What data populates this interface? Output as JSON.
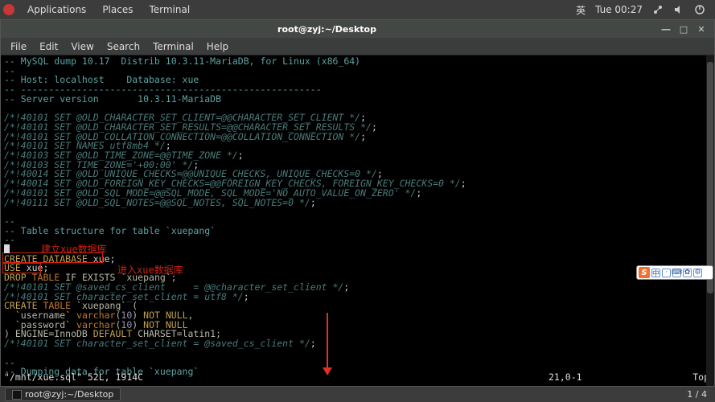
{
  "top_panel": {
    "menu": [
      "Applications",
      "Places",
      "Terminal"
    ],
    "ime_lang": "英",
    "clock": "Tue 00:27"
  },
  "window": {
    "title": "root@zyj:~/Desktop",
    "menubar": [
      "File",
      "Edit",
      "View",
      "Search",
      "Terminal",
      "Help"
    ]
  },
  "terminal_lines": [
    [
      [
        "c-cyan",
        "-- MySQL dump 10.17  Distrib 10.3.11-MariaDB, for Linux (x86_64)"
      ]
    ],
    [
      [
        "c-cyan",
        "--"
      ]
    ],
    [
      [
        "c-cyan",
        "-- Host: localhost    Database: xue"
      ]
    ],
    [
      [
        "c-cyan",
        "-- ------------------------------------------------------"
      ]
    ],
    [
      [
        "c-cyan",
        "-- Server version       10.3.11-MariaDB"
      ]
    ],
    [
      [
        "c-white",
        ""
      ]
    ],
    [
      [
        "c-comment",
        "/*!40101 SET @OLD_CHARACTER_SET_CLIENT=@@CHARACTER_SET_CLIENT */"
      ],
      [
        "c-white",
        ";"
      ]
    ],
    [
      [
        "c-comment",
        "/*!40101 SET @OLD_CHARACTER_SET_RESULTS=@@CHARACTER_SET_RESULTS */"
      ],
      [
        "c-white",
        ";"
      ]
    ],
    [
      [
        "c-comment",
        "/*!40101 SET @OLD_COLLATION_CONNECTION=@@COLLATION_CONNECTION */"
      ],
      [
        "c-white",
        ";"
      ]
    ],
    [
      [
        "c-comment",
        "/*!40101 SET NAMES utf8mb4 */"
      ],
      [
        "c-white",
        ";"
      ]
    ],
    [
      [
        "c-comment",
        "/*!40103 SET @OLD_TIME_ZONE=@@TIME_ZONE */"
      ],
      [
        "c-white",
        ";"
      ]
    ],
    [
      [
        "c-comment",
        "/*!40103 SET TIME_ZONE='+00:00' */"
      ],
      [
        "c-white",
        ";"
      ]
    ],
    [
      [
        "c-comment",
        "/*!40014 SET @OLD_UNIQUE_CHECKS=@@UNIQUE_CHECKS, UNIQUE_CHECKS=0 */"
      ],
      [
        "c-white",
        ";"
      ]
    ],
    [
      [
        "c-comment",
        "/*!40014 SET @OLD_FOREIGN_KEY_CHECKS=@@FOREIGN_KEY_CHECKS, FOREIGN_KEY_CHECKS=0 */"
      ],
      [
        "c-white",
        ";"
      ]
    ],
    [
      [
        "c-comment",
        "/*!40101 SET @OLD_SQL_MODE=@@SQL_MODE, SQL_MODE='NO_AUTO_VALUE_ON_ZERO' */"
      ],
      [
        "c-white",
        ";"
      ]
    ],
    [
      [
        "c-comment",
        "/*!40111 SET @OLD_SQL_NOTES=@@SQL_NOTES, SQL_NOTES=0 */"
      ],
      [
        "c-white",
        ";"
      ]
    ],
    [
      [
        "c-white",
        ""
      ]
    ],
    [
      [
        "c-cyan",
        "--"
      ]
    ],
    [
      [
        "c-cyan",
        "-- Table structure for table `xuepang`"
      ]
    ],
    [
      [
        "c-cyan",
        "--"
      ]
    ],
    [
      [
        "c-white",
        ""
      ]
    ],
    [
      [
        "c-yellow",
        "CREATE DATABASE"
      ],
      [
        "c-white",
        " xue;"
      ]
    ],
    [
      [
        "c-yellow",
        "USE"
      ],
      [
        "c-white",
        " xue;"
      ]
    ],
    [
      [
        "c-yellow",
        "DROP"
      ],
      [
        "c-orange",
        " TABLE"
      ],
      [
        "c-text",
        " IF EXISTS `xuepang`;"
      ]
    ],
    [
      [
        "c-comment",
        "/*!40101 SET @saved_cs_client     = @@character_set_client */"
      ],
      [
        "c-white",
        ";"
      ]
    ],
    [
      [
        "c-comment",
        "/*!40101 SET character_set_client = utf8 */"
      ],
      [
        "c-white",
        ";"
      ]
    ],
    [
      [
        "c-yellow",
        "CREATE"
      ],
      [
        "c-orange",
        " TABLE"
      ],
      [
        "c-text",
        " `xuepang` ("
      ]
    ],
    [
      [
        "c-text",
        "  `username` "
      ],
      [
        "c-orange",
        "varchar"
      ],
      [
        "c-text",
        "("
      ],
      [
        "c-purple",
        "10"
      ],
      [
        "c-text",
        ") "
      ],
      [
        "c-yellow",
        "NOT NULL"
      ],
      [
        "c-text",
        ","
      ]
    ],
    [
      [
        "c-text",
        "  `password` "
      ],
      [
        "c-orange",
        "varchar"
      ],
      [
        "c-text",
        "("
      ],
      [
        "c-purple",
        "10"
      ],
      [
        "c-text",
        ") "
      ],
      [
        "c-yellow",
        "NOT NULL"
      ]
    ],
    [
      [
        "c-text",
        ") ENGINE=InnoDB "
      ],
      [
        "c-yellow",
        "DEFAULT"
      ],
      [
        "c-text",
        " CHARSET=latin1;"
      ]
    ],
    [
      [
        "c-comment",
        "/*!40101 SET character_set_client = @saved_cs_client */"
      ],
      [
        "c-white",
        ";"
      ]
    ],
    [
      [
        "c-white",
        ""
      ]
    ],
    [
      [
        "c-cyan",
        "--"
      ]
    ],
    [
      [
        "c-cyan",
        "-- Dumping data for table `xuepang`"
      ]
    ]
  ],
  "annotations": {
    "label1": "建立xue数据库",
    "label2": "进入xue数据库"
  },
  "status": {
    "left": "\"/mnt/xue.sql\" 52L, 1914C",
    "mid": "21,0-1",
    "right": "Top"
  },
  "taskbar": {
    "item_label": "root@zyj:~/Desktop",
    "workspace": "1 / 4"
  },
  "ime_float": {
    "badge": "S",
    "char": "中"
  }
}
